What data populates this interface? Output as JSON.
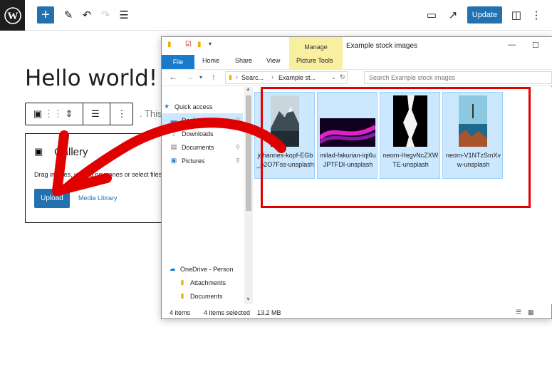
{
  "wordpress": {
    "update_label": "Update",
    "post_title": "Hello world!",
    "paragraph_preview": ". This",
    "gallery": {
      "title": "Gallery",
      "description": "Drag images, upload new ones or select files",
      "upload_label": "Upload",
      "media_library_label": "Media Library"
    }
  },
  "explorer": {
    "window_title": "Example stock images",
    "manage_label": "Manage",
    "ribbon_tabs": [
      "File",
      "Home",
      "Share",
      "View",
      "Picture Tools"
    ],
    "address": {
      "crumbs": [
        "Searc...",
        "Example st..."
      ]
    },
    "search_placeholder": "Search Example stock images",
    "nav": {
      "quick_access": "Quick access",
      "desktop": "Desktop",
      "downloads": "Downloads",
      "documents": "Documents",
      "pictures": "Pictures",
      "onedrive": "OneDrive - Person",
      "attachments": "Attachments",
      "documents2": "Documents"
    },
    "files": [
      {
        "name": "johannes-kopf-EGb_p2O7Fss-unsplash"
      },
      {
        "name": "milad-fakurian-iqi6uJPTFDI-unsplash"
      },
      {
        "name": "neom-HegvNcZXWTE-unsplash"
      },
      {
        "name": "neom-V1NTzSmXvw-unsplash"
      }
    ],
    "status": {
      "items": "4 items",
      "selected": "4 items selected",
      "size": "13.2 MB"
    }
  },
  "colors": {
    "wp_blue": "#2271b1",
    "annotation_red": "#e00000",
    "selection": "#cce8ff",
    "manage_yellow": "#f8f0a0"
  }
}
